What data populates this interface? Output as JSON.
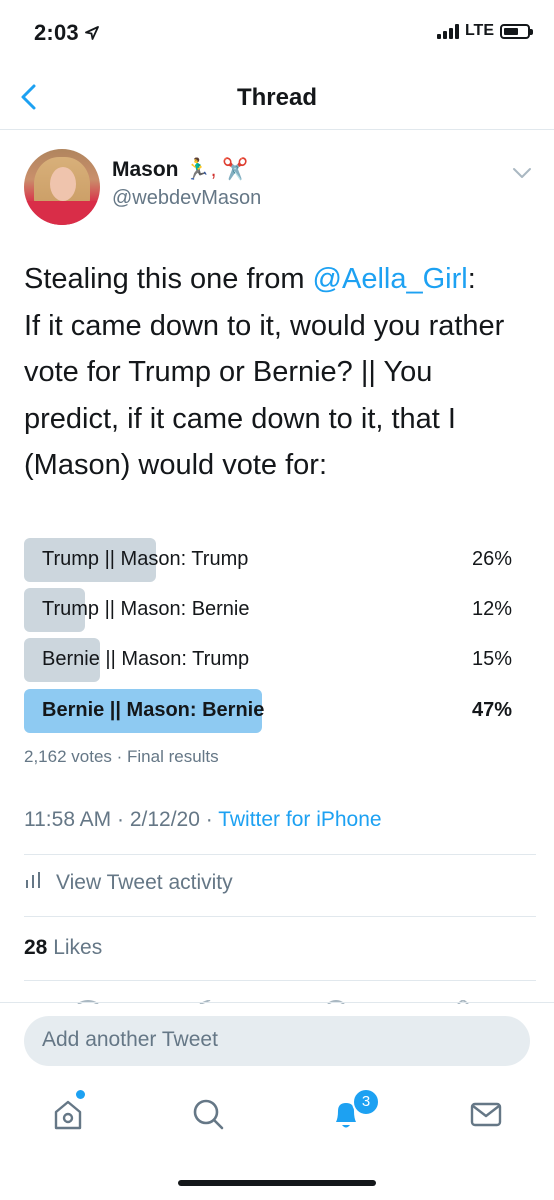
{
  "status_bar": {
    "time": "2:03",
    "network": "LTE"
  },
  "nav": {
    "title": "Thread"
  },
  "tweet": {
    "author_name": "Mason",
    "author_emoji": "🏃‍♂️, ✂️",
    "handle": "@webdevMason",
    "text_prefix": "Stealing this one from ",
    "mention": "@Aella_Girl",
    "text_suffix": ":\nIf it came down to it, would you rather vote for Trump or Bernie? || You predict, if it came down to it, that I (Mason) would vote for:",
    "poll": {
      "options": [
        {
          "label": "Trump || Mason: Trump",
          "percent_text": "26%",
          "percent": 26,
          "winner": false
        },
        {
          "label": "Trump || Mason: Bernie",
          "percent_text": "12%",
          "percent": 12,
          "winner": false
        },
        {
          "label": "Bernie || Mason: Trump",
          "percent_text": "15%",
          "percent": 15,
          "winner": false
        },
        {
          "label": "Bernie || Mason: Bernie",
          "percent_text": "47%",
          "percent": 47,
          "winner": true
        }
      ],
      "votes": "2,162 votes",
      "separator": " · ",
      "status": "Final results"
    },
    "time": "11:58 AM · 2/12/20 · ",
    "source": "Twitter for iPhone",
    "activity_label": "View Tweet activity",
    "likes_count": "28",
    "likes_label": " Likes"
  },
  "reply": {
    "placeholder": "Add another Tweet"
  },
  "tab_bar": {
    "notifications_badge": "3"
  },
  "colors": {
    "accent": "#1da1f2",
    "muted": "#657786",
    "bar": "#ccd6dd",
    "bar_winner": "#8ecaf2"
  }
}
